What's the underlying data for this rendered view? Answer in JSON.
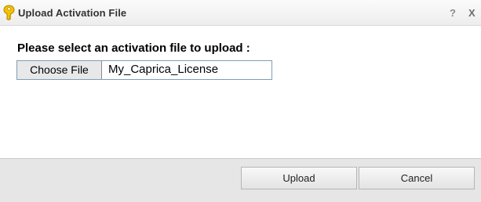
{
  "dialog": {
    "title": "Upload Activation File",
    "title_icon": "key-icon",
    "help_label": "?",
    "close_label": "X"
  },
  "form": {
    "prompt": "Please select an activation file to upload :",
    "choose_label": "Choose File",
    "file_name": "My_Caprica_License"
  },
  "footer": {
    "upload_label": "Upload",
    "cancel_label": "Cancel"
  },
  "colors": {
    "key_icon": "#f2c200",
    "titlebar": "#efefef",
    "footer": "#e6e6e6",
    "input_border": "#7f9db9"
  }
}
